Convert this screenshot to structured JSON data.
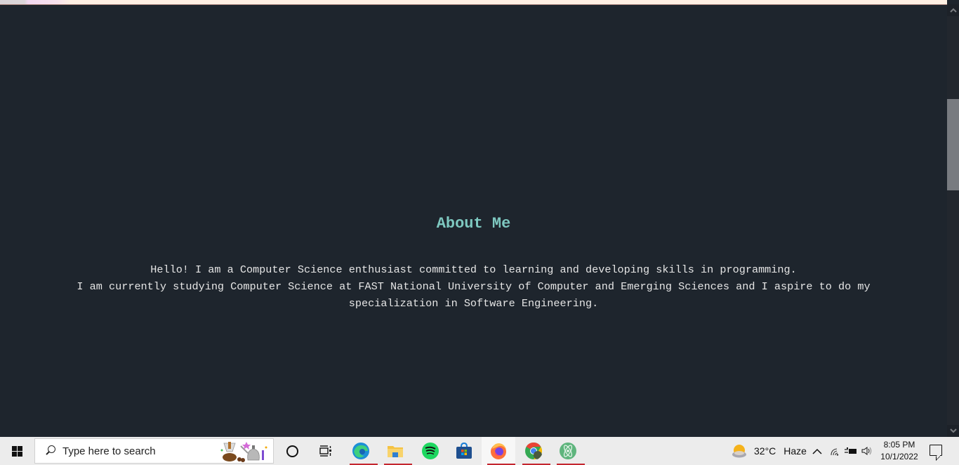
{
  "page": {
    "section_title": "About Me",
    "about_lines": [
      "Hello! I am a Computer Science enthusiast committed to learning and developing skills in programming.",
      "I am currently studying Computer Science at FAST National University of Computer and Emerging Sciences and I aspire to do my",
      "specialization in Software Engineering."
    ],
    "colors": {
      "background": "#1e252d",
      "title": "#7ec8c0",
      "text": "#e6e6e6"
    }
  },
  "scrollbar": {
    "up_icon": "▲",
    "down_icon": "▼",
    "position_fraction": 0.22
  },
  "taskbar": {
    "search_placeholder": "Type here to search",
    "apps": [
      {
        "name": "Task View",
        "icon": "task-view-icon",
        "running": false
      },
      {
        "name": "Microsoft Edge",
        "icon": "edge-icon",
        "running": true
      },
      {
        "name": "File Explorer",
        "icon": "file-explorer-icon",
        "running": true
      },
      {
        "name": "Spotify",
        "icon": "spotify-icon",
        "running": false
      },
      {
        "name": "Microsoft Store",
        "icon": "store-icon",
        "running": false
      },
      {
        "name": "Firefox",
        "icon": "firefox-icon",
        "running": true,
        "active": true
      },
      {
        "name": "Google Chrome",
        "icon": "chrome-icon",
        "running": true
      },
      {
        "name": "Atom",
        "icon": "atom-icon",
        "running": true
      }
    ],
    "weather": {
      "temperature": "32°C",
      "condition": "Haze"
    },
    "clock": {
      "time": "8:05 PM",
      "date": "10/1/2022"
    }
  }
}
